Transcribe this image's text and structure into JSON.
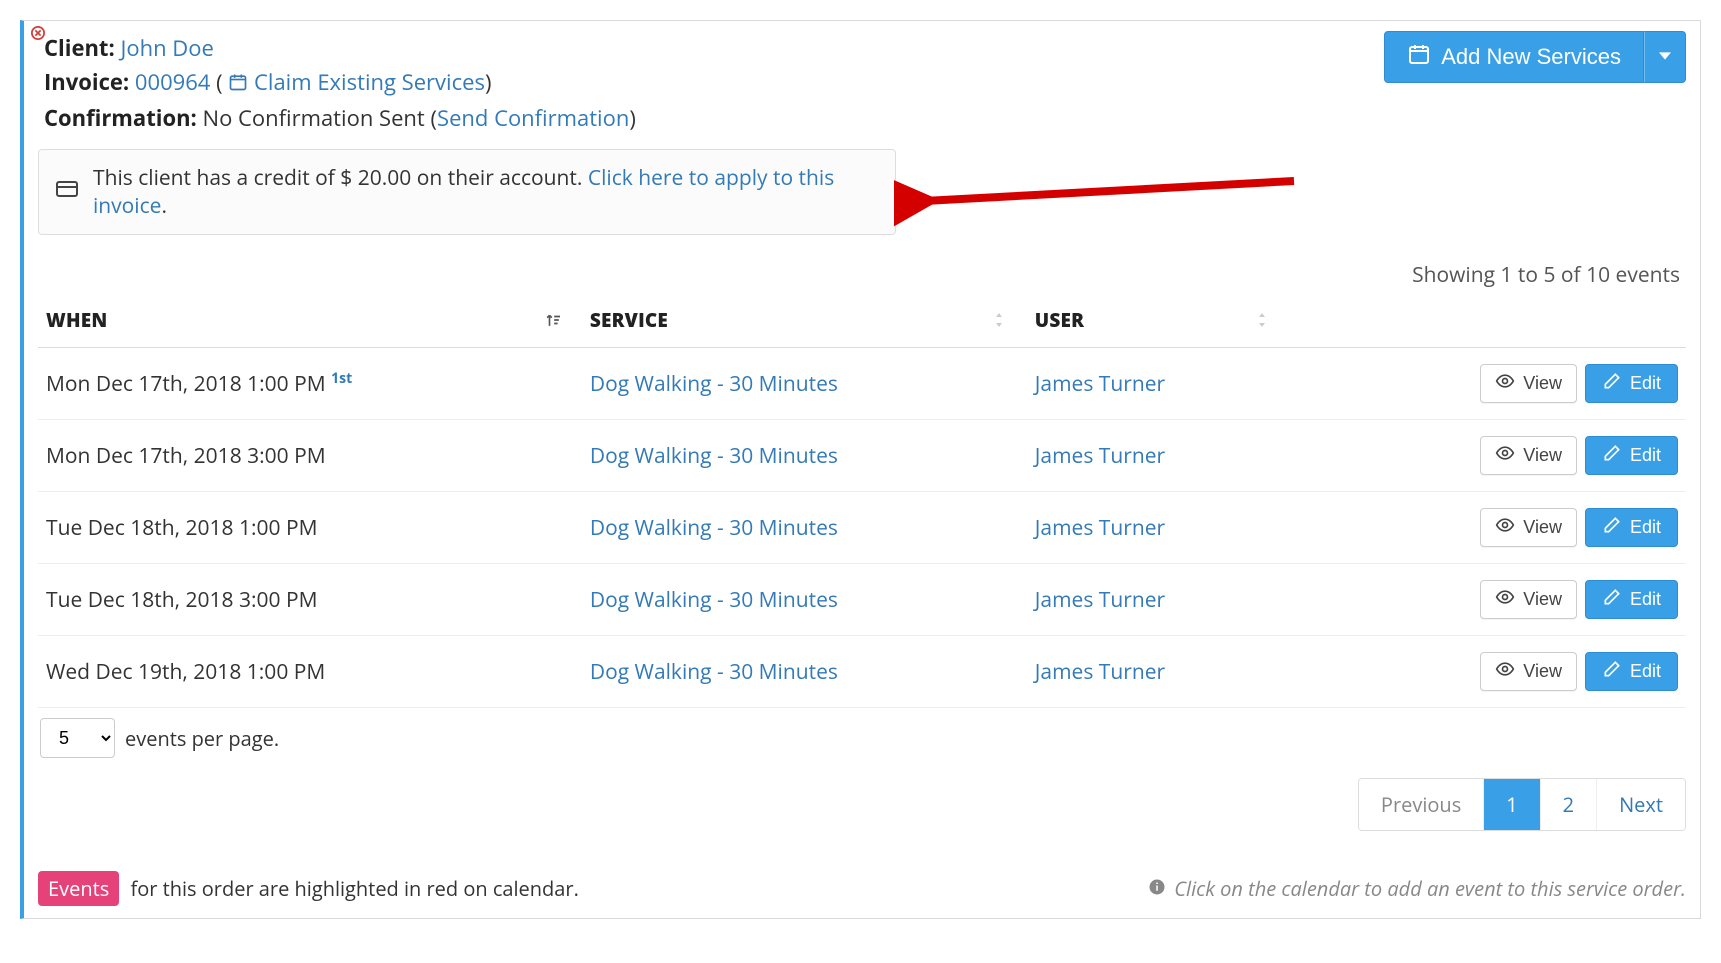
{
  "header": {
    "client_label": "Client:",
    "client_name": "John Doe",
    "invoice_label": "Invoice:",
    "invoice_number": "000964",
    "claim_label": "Claim Existing Services",
    "confirmation_label": "Confirmation:",
    "confirmation_status": "No Confirmation Sent",
    "send_confirmation": "Send Confirmation",
    "add_services_label": "Add New Services"
  },
  "alert": {
    "text_prefix": "This client has a credit of $ ",
    "amount": "20.00",
    "text_suffix": " on their account. ",
    "link_text": "Click here to apply to this invoice",
    "period": "."
  },
  "table": {
    "summary": "Showing 1 to 5 of 10 events",
    "col_when": "WHEN",
    "col_service": "SERVICE",
    "col_user": "USER",
    "view_label": "View",
    "edit_label": "Edit",
    "rows": [
      {
        "when": "Mon Dec 17th, 2018 1:00 PM",
        "badge": "1st",
        "service": "Dog Walking - 30 Minutes",
        "user": "James Turner"
      },
      {
        "when": "Mon Dec 17th, 2018 3:00 PM",
        "badge": "",
        "service": "Dog Walking - 30 Minutes",
        "user": "James Turner"
      },
      {
        "when": "Tue Dec 18th, 2018 1:00 PM",
        "badge": "",
        "service": "Dog Walking - 30 Minutes",
        "user": "James Turner"
      },
      {
        "when": "Tue Dec 18th, 2018 3:00 PM",
        "badge": "",
        "service": "Dog Walking - 30 Minutes",
        "user": "James Turner"
      },
      {
        "when": "Wed Dec 19th, 2018 1:00 PM",
        "badge": "",
        "service": "Dog Walking - 30 Minutes",
        "user": "James Turner"
      }
    ]
  },
  "perpage": {
    "value": "5",
    "suffix": "events per page."
  },
  "pagination": {
    "previous": "Previous",
    "pages": [
      "1",
      "2"
    ],
    "active_index": 0,
    "next": "Next"
  },
  "footer": {
    "badge": "Events",
    "text": "for this order are highlighted in red on calendar.",
    "hint": "Click on the calendar to add an event to this service order."
  }
}
